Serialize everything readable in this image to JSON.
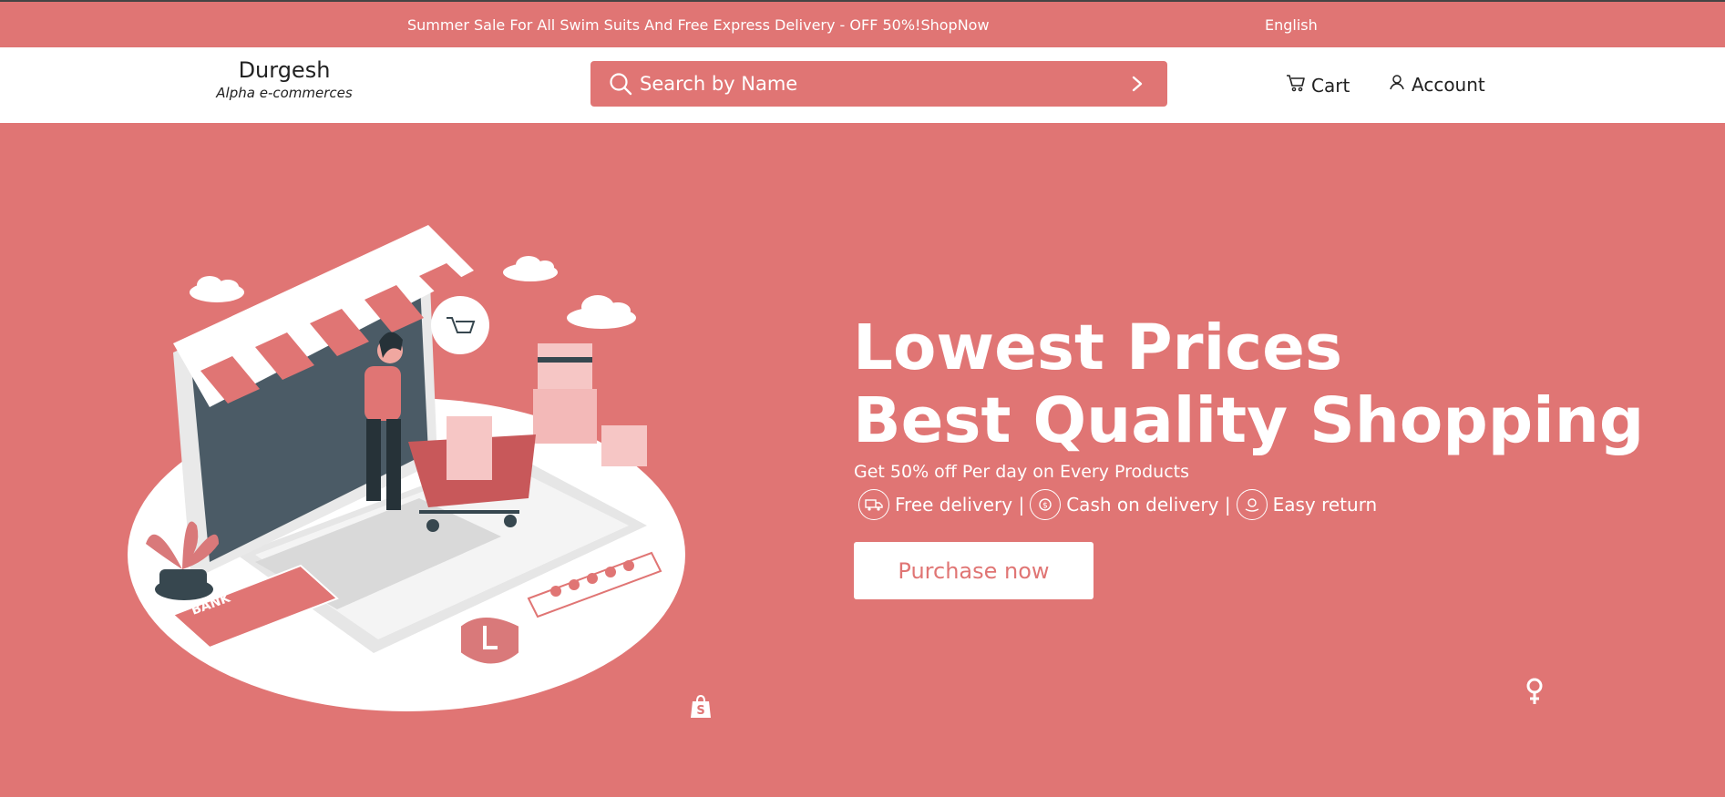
{
  "topbar": {
    "promo": "Summer Sale For All Swim Suits And Free Express Delivery - OFF 50%!ShopNow",
    "language": "English"
  },
  "header": {
    "brand_name": "Durgesh",
    "brand_tagline": "Alpha e-commerces",
    "search_placeholder": "Search by Name",
    "cart_label": "Cart",
    "account_label": "Account"
  },
  "hero": {
    "headline_line1": "Lowest Prices",
    "headline_line2": "Best Quality Shopping",
    "subline": "Get 50% off Per day on Every Products",
    "features": [
      "Free delivery |",
      "Cash on delivery |",
      "Easy return"
    ],
    "cta_label": "Purchase now",
    "illustration_card_text": "BANK"
  },
  "colors": {
    "accent": "#e07574",
    "dark": "#37474f",
    "white": "#ffffff"
  },
  "icons": [
    "search-icon",
    "chevron-right-icon",
    "cart-icon",
    "user-icon",
    "truck-icon",
    "cash-icon",
    "return-icon",
    "shopify-icon",
    "female-symbol-icon"
  ]
}
